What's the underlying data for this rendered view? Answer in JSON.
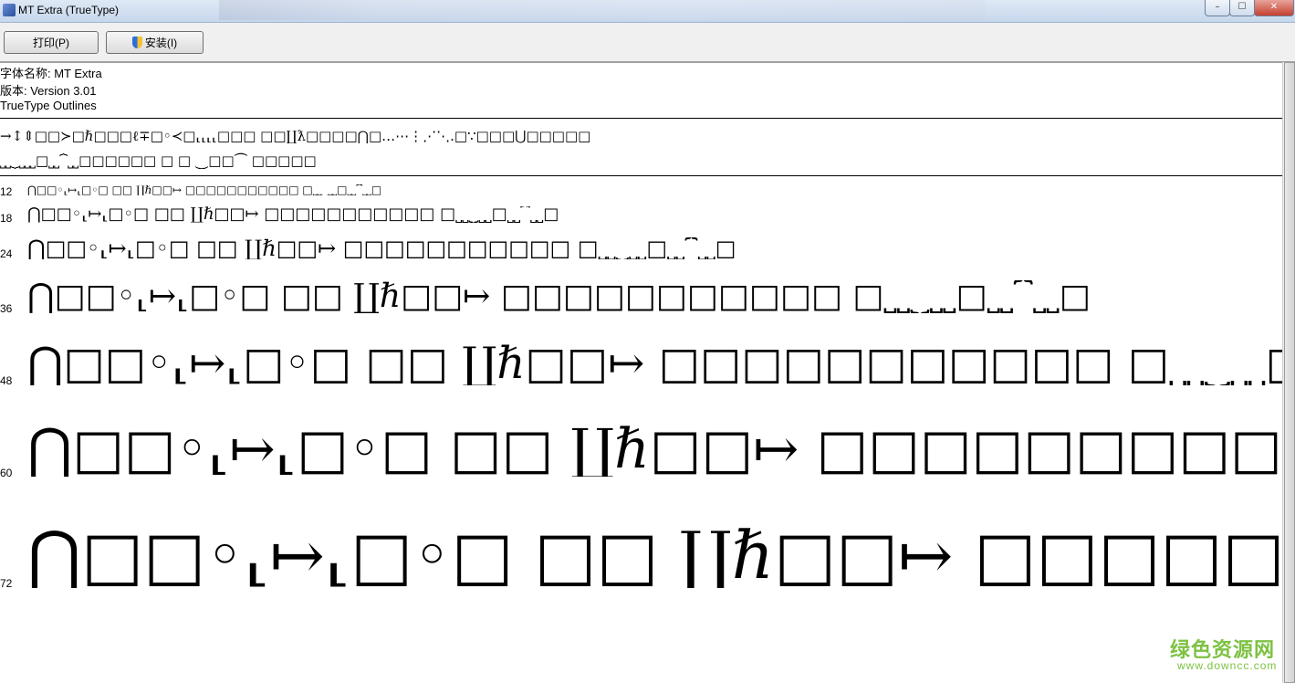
{
  "window": {
    "title": "MT Extra (TrueType)",
    "minimize_glyph": "–",
    "maximize_glyph": "☐",
    "close_glyph": "✕"
  },
  "toolbar": {
    "print_label": "打印(P)",
    "install_label": "安装(I)"
  },
  "font_info": {
    "name_line": "字体名称: MT Extra",
    "version_line": "版本: Version 3.01",
    "type_line": "TrueType Outlines"
  },
  "charset": {
    "line1": "→↕⇕□□≻□ℏ□□□ℓ∓□◦≺□⸤⸤⸤⸤□□□ □□∐ƛ□□□□⋂□…⋯⋮⋰⋱.□∵□□□⋃□□□□□",
    "line2": "⎵⎵⏟⎵⎵⎵□⎵⎵⏞⎵⎵□□□□□□ □ □ ⏝□□⏜ □□□□□"
  },
  "samples": [
    {
      "size": "12",
      "text": "⋂□□◦⸤↦⸤□◦□ □□ ∐ℏ□□↦ □□□□□□□□□□□ □⎵⎵⏟⎵⎵□⎵⎵⏞⎵⎵□"
    },
    {
      "size": "18",
      "text": "⋂□□◦⸤↦⸤□◦□ □□ ∐ℏ□□↦ □□□□□□□□□□□ □⎵⎵⏟⎵⎵□⎵⎵⏞⎵⎵□"
    },
    {
      "size": "24",
      "text": "⋂□□◦⸤↦⸤□◦□ □□ ∐ℏ□□↦ □□□□□□□□□□□ □⎵⎵⏟⎵⎵□⎵⎵⏞⎵⎵□"
    },
    {
      "size": "36",
      "text": "⋂□□◦⸤↦⸤□◦□ □□ ∐ℏ□□↦ □□□□□□□□□□□ □⎵⎵⏟⎵⎵□⎵⎵⏞⎵⎵□"
    },
    {
      "size": "48",
      "text": "⋂□□◦⸤↦⸤□◦□ □□ ∐ℏ□□↦ □□□□□□□□□□□ □⎵⎵⏟⎵⎵□⎵⎵⏞"
    },
    {
      "size": "60",
      "text": "⋂□□◦⸤↦⸤□◦□ □□ ∐ℏ□□↦ □□□□□□□□□□□ □⎵⎵"
    },
    {
      "size": "72",
      "text": "⋂□□◦⸤↦⸤□◦□ □□ ∐ℏ□□↦ □□□□□□□□□□"
    }
  ],
  "watermark": {
    "text": "绿色资源网",
    "url": "www.downcc.com"
  }
}
